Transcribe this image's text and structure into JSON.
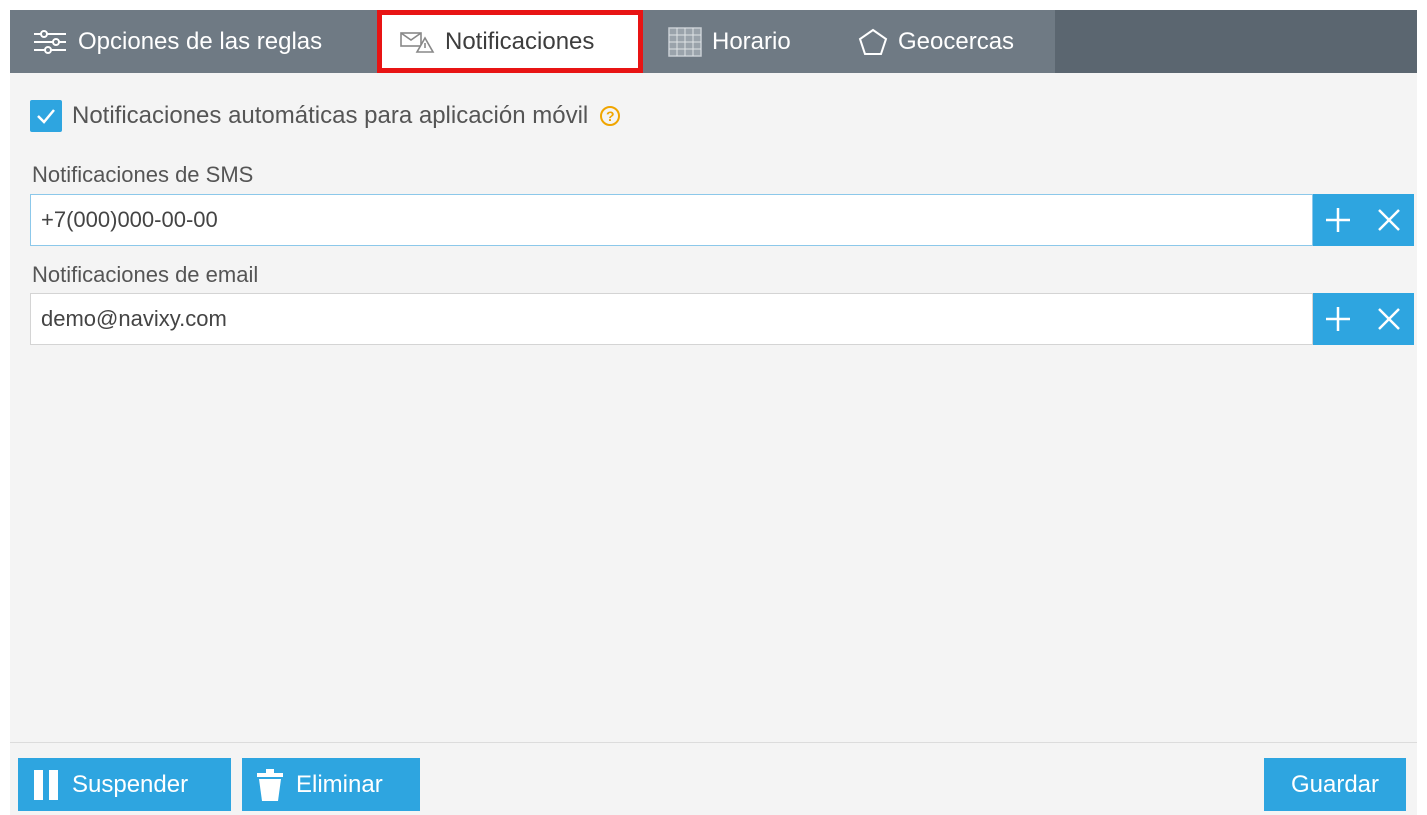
{
  "tabs": [
    {
      "label": "Opciones de las reglas",
      "icon": "sliders-icon"
    },
    {
      "label": "Notificaciones",
      "icon": "envelope-alert-icon",
      "active": true
    },
    {
      "label": "Horario",
      "icon": "calendar-icon"
    },
    {
      "label": "Geocercas",
      "icon": "pentagon-icon"
    }
  ],
  "mobile_notifications": {
    "label": "Notificaciones automáticas para aplicación móvil",
    "checked": true,
    "help": "?"
  },
  "sms": {
    "label": "Notificaciones de SMS",
    "value": "+7(000)000-00-00"
  },
  "email": {
    "label": "Notificaciones de email",
    "value": "demo@navixy.com"
  },
  "footer": {
    "suspend_label": "Suspender",
    "delete_label": "Eliminar",
    "save_label": "Guardar"
  },
  "colors": {
    "accent": "#2ea5e0",
    "tabbar": "#6f7a84",
    "highlight": "#e81414"
  }
}
